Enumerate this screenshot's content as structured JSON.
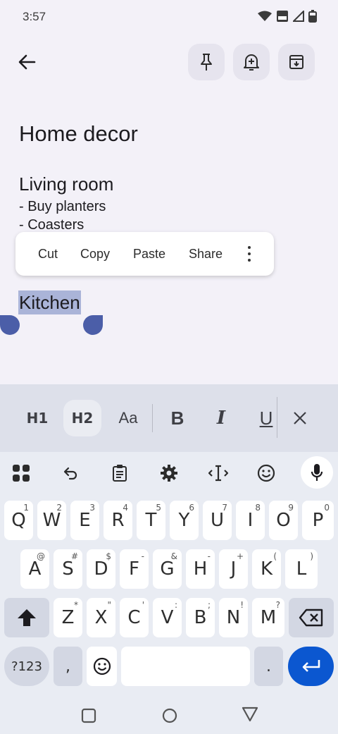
{
  "status": {
    "time": "3:57"
  },
  "note": {
    "title": "Home decor",
    "heading": "Living room",
    "lines": [
      "- Buy planters",
      "- Coasters"
    ],
    "selected": "Kitchen"
  },
  "context_menu": {
    "cut": "Cut",
    "copy": "Copy",
    "paste": "Paste",
    "share": "Share"
  },
  "format_bar": {
    "h1": "H1",
    "h2": "H2",
    "aa": "Aa",
    "bold": "B",
    "italic": "I",
    "underline": "U"
  },
  "keyboard": {
    "row1": [
      {
        "k": "Q",
        "h": "1"
      },
      {
        "k": "W",
        "h": "2"
      },
      {
        "k": "E",
        "h": "3"
      },
      {
        "k": "R",
        "h": "4"
      },
      {
        "k": "T",
        "h": "5"
      },
      {
        "k": "Y",
        "h": "6"
      },
      {
        "k": "U",
        "h": "7"
      },
      {
        "k": "I",
        "h": "8"
      },
      {
        "k": "O",
        "h": "9"
      },
      {
        "k": "P",
        "h": "0"
      }
    ],
    "row2": [
      {
        "k": "A",
        "h": "@"
      },
      {
        "k": "S",
        "h": "#"
      },
      {
        "k": "D",
        "h": "$"
      },
      {
        "k": "F",
        "h": "-"
      },
      {
        "k": "G",
        "h": "&"
      },
      {
        "k": "H",
        "h": "-"
      },
      {
        "k": "J",
        "h": "+"
      },
      {
        "k": "K",
        "h": "("
      },
      {
        "k": "L",
        "h": ")"
      }
    ],
    "row3": [
      {
        "k": "Z",
        "h": "*"
      },
      {
        "k": "X",
        "h": "\""
      },
      {
        "k": "C",
        "h": "'"
      },
      {
        "k": "V",
        "h": ":"
      },
      {
        "k": "B",
        "h": ";"
      },
      {
        "k": "N",
        "h": "!"
      },
      {
        "k": "M",
        "h": "?"
      }
    ],
    "symbols": "?123",
    "comma": ",",
    "period": "."
  },
  "colors": {
    "accent": "#0b57d0",
    "selection": "#aab4d8",
    "handle": "#4b5ea8"
  },
  "icons": [
    "back-arrow-icon",
    "pin-icon",
    "bell-plus-icon",
    "archive-icon",
    "apps-grid-icon",
    "undo-icon",
    "clipboard-icon",
    "gear-icon",
    "cursor-move-icon",
    "emoji-icon",
    "mic-icon",
    "shift-icon",
    "backspace-icon",
    "enter-icon",
    "nav-recents-icon",
    "nav-home-icon",
    "nav-back-icon"
  ]
}
